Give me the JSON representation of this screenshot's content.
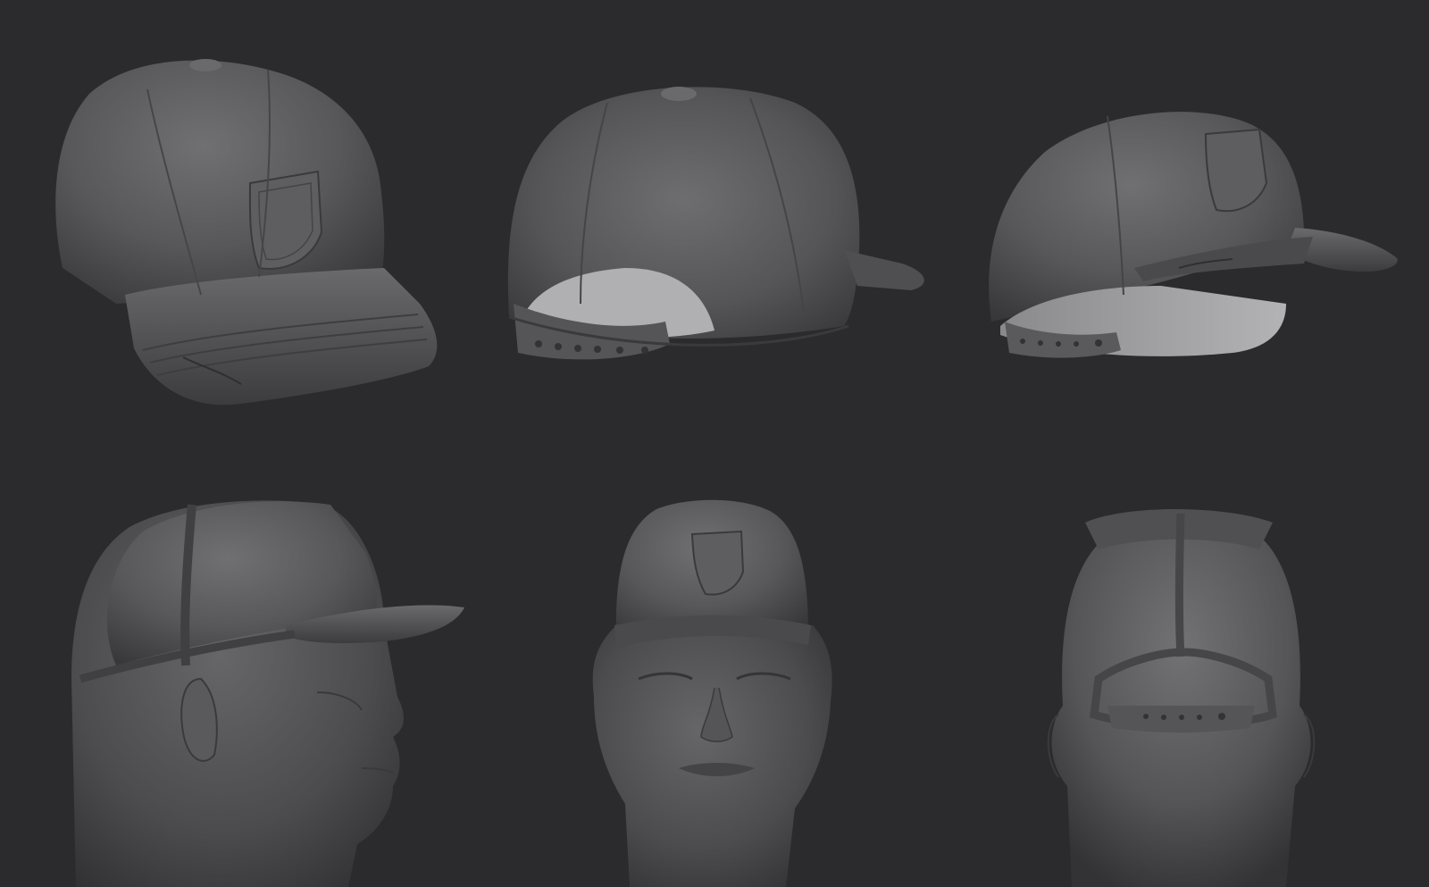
{
  "sheet": {
    "background": "#2b2b2d",
    "material": "#5a5a5c"
  },
  "renders": [
    {
      "name": "cap-three-quarter-front-view"
    },
    {
      "name": "cap-rear-view"
    },
    {
      "name": "cap-low-side-view"
    },
    {
      "name": "head-with-cap-profile-view"
    },
    {
      "name": "head-with-cap-front-view"
    },
    {
      "name": "head-with-cap-back-view"
    }
  ]
}
